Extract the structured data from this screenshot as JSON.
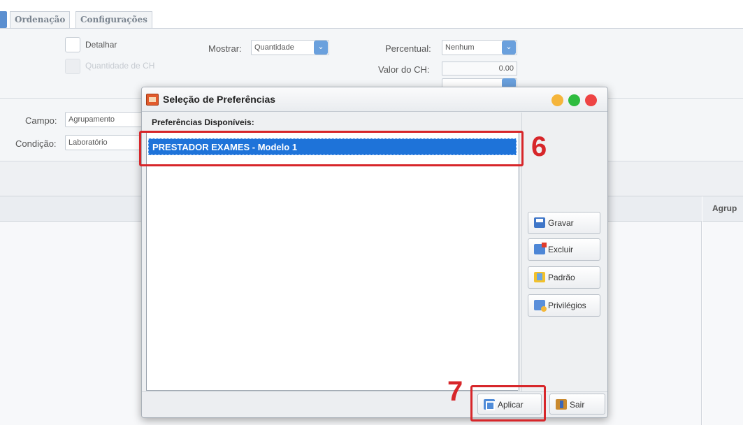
{
  "tabs": [
    "Ordenação",
    "Configurações"
  ],
  "settings": {
    "detail_label": "Detalhar",
    "qty_ch_label": "Quantidade de CH",
    "show_label": "Mostrar:",
    "show_value": "Quantidade",
    "percent_label": "Percentual:",
    "percent_value": "Nenhum",
    "ch_value_label": "Valor do CH:",
    "ch_value": "0.00"
  },
  "filters": {
    "field_label": "Campo:",
    "field_value": "Agrupamento",
    "condition_label": "Condição:",
    "condition_value": "Laboratório"
  },
  "grid": {
    "right_header": "Agrup"
  },
  "dialog": {
    "title": "Seleção de Preferências",
    "list_header": "Preferências Disponíveis:",
    "items": [
      "PRESTADOR EXAMES - Modelo 1"
    ],
    "buttons": {
      "save": "Gravar",
      "delete": "Excluir",
      "default": "Padrão",
      "privileges": "Privilégios",
      "apply": "Aplicar",
      "exit": "Sair"
    }
  },
  "annotations": {
    "step6": "6",
    "step7": "7",
    "color": "#d7262a"
  }
}
